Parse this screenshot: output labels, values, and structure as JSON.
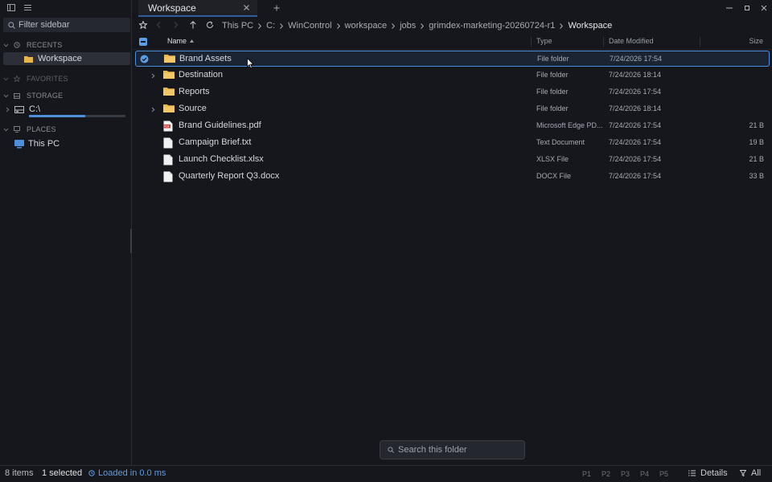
{
  "sidebar": {
    "filter_placeholder": "Filter sidebar",
    "sections": {
      "recents": "RECENTS",
      "favorites": "FAVORITES",
      "storage": "STORAGE",
      "places": "PLACES"
    },
    "recents_items": [
      "Workspace"
    ],
    "storage_items": [
      {
        "label": "C:\\",
        "usage_fraction": 0.58
      }
    ],
    "places_items": [
      "This PC"
    ]
  },
  "tab": {
    "label": "Workspace"
  },
  "breadcrumb": [
    "This PC",
    "C:",
    "WinControl",
    "workspace",
    "jobs",
    "grimdex-marketing-20260724-r1",
    "Workspace"
  ],
  "columns": {
    "name": "Name",
    "type": "Type",
    "date": "Date Modified",
    "size": "Size"
  },
  "files": [
    {
      "name": "Brand Assets",
      "type": "File folder",
      "date": "7/24/2026 17:54",
      "size": "",
      "kind": "folder",
      "expandable": false,
      "selected": true
    },
    {
      "name": "Destination",
      "type": "File folder",
      "date": "7/24/2026 18:14",
      "size": "",
      "kind": "folder",
      "expandable": true,
      "selected": false
    },
    {
      "name": "Reports",
      "type": "File folder",
      "date": "7/24/2026 17:54",
      "size": "",
      "kind": "folder",
      "expandable": false,
      "selected": false
    },
    {
      "name": "Source",
      "type": "File folder",
      "date": "7/24/2026 18:14",
      "size": "",
      "kind": "folder",
      "expandable": true,
      "selected": false
    },
    {
      "name": "Brand Guidelines.pdf",
      "type": "Microsoft Edge PD...",
      "date": "7/24/2026 17:54",
      "size": "21 B",
      "kind": "pdf",
      "expandable": false,
      "selected": false
    },
    {
      "name": "Campaign Brief.txt",
      "type": "Text Document",
      "date": "7/24/2026 17:54",
      "size": "19 B",
      "kind": "file",
      "expandable": false,
      "selected": false
    },
    {
      "name": "Launch Checklist.xlsx",
      "type": "XLSX File",
      "date": "7/24/2026 17:54",
      "size": "21 B",
      "kind": "file",
      "expandable": false,
      "selected": false
    },
    {
      "name": "Quarterly Report Q3.docx",
      "type": "DOCX File",
      "date": "7/24/2026 17:54",
      "size": "33 B",
      "kind": "file",
      "expandable": false,
      "selected": false
    }
  ],
  "search": {
    "placeholder": "Search this folder"
  },
  "status": {
    "items": "8 items",
    "selected": "1 selected",
    "loaded": "Loaded in 0.0 ms",
    "panes": [
      "P1",
      "P2",
      "P3",
      "P4",
      "P5"
    ],
    "view": "Details",
    "filter": "All"
  },
  "colors": {
    "accent": "#4a8fdc",
    "background": "#15171c",
    "folder": "#e8b54a"
  }
}
